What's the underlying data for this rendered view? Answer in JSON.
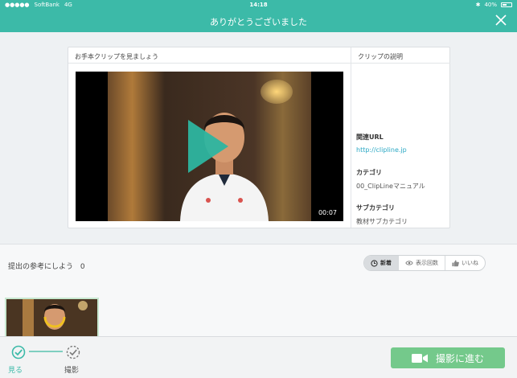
{
  "status_bar": {
    "carrier": "SoftBank",
    "network": "4G",
    "time": "14:18",
    "battery": "40%"
  },
  "header": {
    "title": "ありがとうございました",
    "close_icon": "close-icon"
  },
  "card": {
    "left_heading": "お手本クリップを見ましょう",
    "right_heading": "クリップの説明",
    "video_duration": "00:07",
    "related_url_label": "関連URL",
    "related_url": "http://clipline.jp",
    "category_label": "カテゴリ",
    "category": "00_ClipLineマニュアル",
    "subcategory_label": "サブカテゴリ",
    "subcategory": "教材サブカテゴリ"
  },
  "strip": {
    "label": "提出の参考にしよう",
    "count": "0",
    "sort_tabs": [
      {
        "label": "新着",
        "icon": "clock-icon",
        "active": true
      },
      {
        "label": "表示回数",
        "icon": "eye-icon",
        "active": false
      },
      {
        "label": "いいね",
        "icon": "thumbs-up-icon",
        "active": false
      }
    ]
  },
  "bottom": {
    "steps": [
      {
        "label": "見る",
        "icon": "check-circle-icon"
      },
      {
        "label": "撮影",
        "icon": "dashed-check-circle-icon"
      }
    ],
    "go_button": "撮影に進む",
    "go_button_icon": "video-camera-icon"
  },
  "colors": {
    "header": "#3cbaa8",
    "accent_green": "#74c98b",
    "link": "#2ba8c4",
    "play": "#2db5a0"
  }
}
